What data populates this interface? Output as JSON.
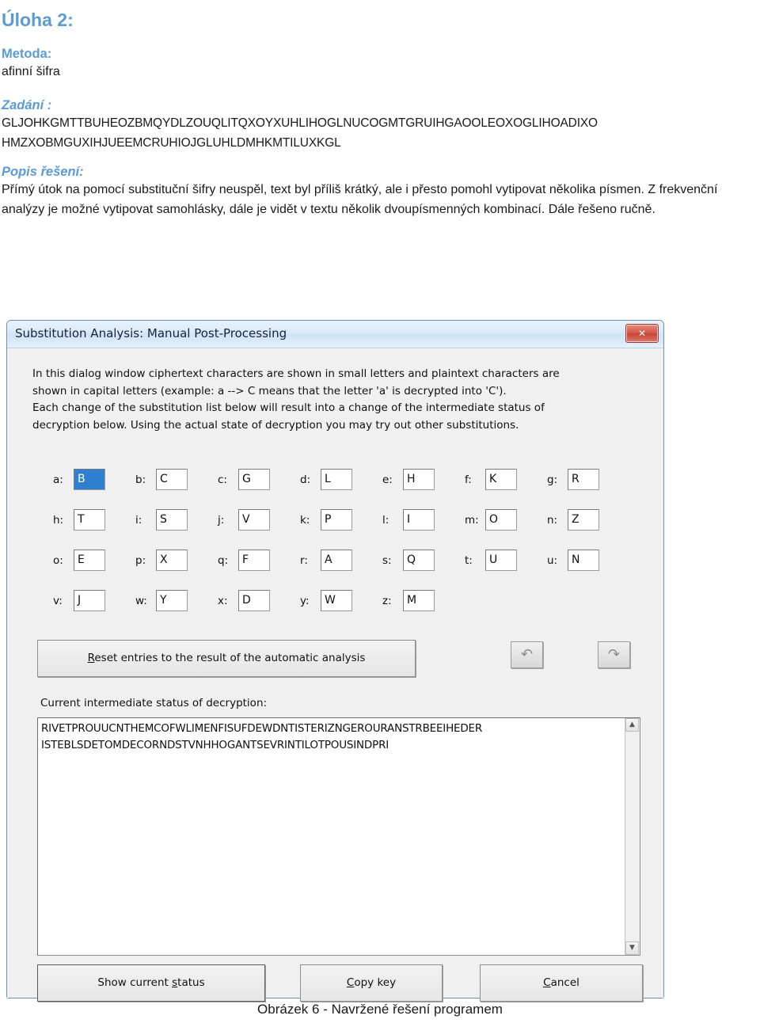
{
  "document": {
    "title": "Úloha 2:",
    "method_heading": "Metoda:",
    "method_value": "afinní šifra",
    "assignment_heading": "Zadání :",
    "ciphertext_line1": "GLJOHKGMTTBUHEOZBMQYDLZOUQLITQXOYXUHLIHOGLNUCOGMTGRUIHGAOOLEOXOGLIHOADIXO",
    "ciphertext_line2": "HMZXOBMGUXIHJUEEMCRUHIOJGLUHLDMHKMTILUXKGL",
    "solution_heading": "Popis řešení:",
    "solution_text": "Přímý útok na pomocí substituční šifry neuspěl, text byl příliš krátký, ale i přesto pomohl vytipovat několika písmen. Z frekvenční analýzy je možné vytipovat samohlásky, dále je vidět v textu několik dvoupísmenných kombinací. Dále řešeno ručně.",
    "figure_caption": "Obrázek 6 - Navržené řešení programem"
  },
  "dialog": {
    "title": "Substitution Analysis: Manual Post-Processing",
    "close_label": "✕",
    "description_line1": "In this dialog window ciphertext characters are shown in small letters and plaintext characters are",
    "description_line2": "shown in capital letters (example: a --> C means that the letter 'a' is decrypted into 'C').",
    "description_line3": "Each change of the substitution list below will result into a change of the intermediate status of",
    "description_line4": "decryption below. Using the actual state of decryption you may try out other substitutions.",
    "substitutions": [
      [
        {
          "cipher": "a:",
          "plain": "B",
          "selected": true
        },
        {
          "cipher": "b:",
          "plain": "C",
          "selected": false
        },
        {
          "cipher": "c:",
          "plain": "G",
          "selected": false
        },
        {
          "cipher": "d:",
          "plain": "L",
          "selected": false
        },
        {
          "cipher": "e:",
          "plain": "H",
          "selected": false
        },
        {
          "cipher": "f:",
          "plain": "K",
          "selected": false
        },
        {
          "cipher": "g:",
          "plain": "R",
          "selected": false
        }
      ],
      [
        {
          "cipher": "h:",
          "plain": "T",
          "selected": false
        },
        {
          "cipher": "i:",
          "plain": "S",
          "selected": false
        },
        {
          "cipher": "j:",
          "plain": "V",
          "selected": false
        },
        {
          "cipher": "k:",
          "plain": "P",
          "selected": false
        },
        {
          "cipher": "l:",
          "plain": "I",
          "selected": false
        },
        {
          "cipher": "m:",
          "plain": "O",
          "selected": false
        },
        {
          "cipher": "n:",
          "plain": "Z",
          "selected": false
        }
      ],
      [
        {
          "cipher": "o:",
          "plain": "E",
          "selected": false
        },
        {
          "cipher": "p:",
          "plain": "X",
          "selected": false
        },
        {
          "cipher": "q:",
          "plain": "F",
          "selected": false
        },
        {
          "cipher": "r:",
          "plain": "A",
          "selected": false
        },
        {
          "cipher": "s:",
          "plain": "Q",
          "selected": false
        },
        {
          "cipher": "t:",
          "plain": "U",
          "selected": false
        },
        {
          "cipher": "u:",
          "plain": "N",
          "selected": false
        }
      ],
      [
        {
          "cipher": "v:",
          "plain": "J",
          "selected": false
        },
        {
          "cipher": "w:",
          "plain": "Y",
          "selected": false
        },
        {
          "cipher": "x:",
          "plain": "D",
          "selected": false
        },
        {
          "cipher": "y:",
          "plain": "W",
          "selected": false
        },
        {
          "cipher": "z:",
          "plain": "M",
          "selected": false
        }
      ]
    ],
    "reset_button": "Reset entries to the result of the automatic analysis",
    "reset_button_accel": "R",
    "undo_icon": "↶",
    "redo_icon": "↷",
    "status_label": "Current intermediate status of decryption:",
    "decryption_line1": "RIVETPROUUCNTHEMCOFWLIMENFISUFDEWDNTISTERIZNGEROURANSTRBEEIHEDER",
    "decryption_line2": "ISTEBLSDETOMDECORNDSTVNHHOGANTSEVRINTILOTPOUSINDPRI",
    "scroll_up_icon": "▲",
    "scroll_down_icon": "▼",
    "buttons": {
      "show_status": "Show current status",
      "show_status_accel": "s",
      "copy_key": "Copy key",
      "copy_key_accel": "C",
      "cancel": "Cancel",
      "cancel_accel": "C"
    }
  },
  "colors": {
    "heading_blue": "#5b9bd5",
    "selection_blue": "#2f7fd1",
    "close_red": "#c44436"
  }
}
